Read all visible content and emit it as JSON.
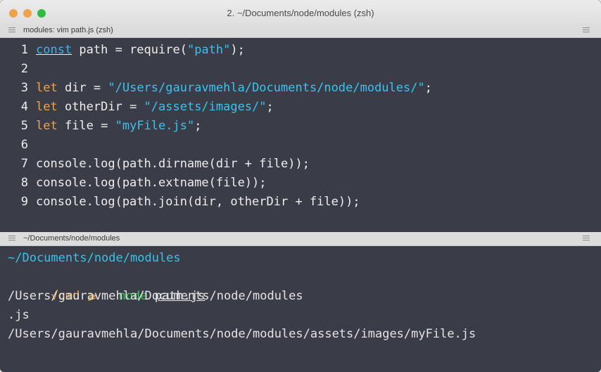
{
  "window": {
    "title": "2. ~/Documents/node/modules (zsh)"
  },
  "editor_pane": {
    "title": "modules: vim path.js (zsh)",
    "lines": [
      {
        "num": "1",
        "parts": [
          [
            "const",
            "kw-const"
          ],
          [
            " path = require(",
            ""
          ],
          [
            "\"path\"",
            "str"
          ],
          [
            ");",
            ""
          ]
        ]
      },
      {
        "num": "2",
        "parts": []
      },
      {
        "num": "3",
        "parts": [
          [
            "let",
            "kw-let"
          ],
          [
            " dir = ",
            ""
          ],
          [
            "\"/Users/gauravmehla/Documents/node/modules/\"",
            "str"
          ],
          [
            ";",
            ""
          ]
        ]
      },
      {
        "num": "4",
        "parts": [
          [
            "let",
            "kw-let"
          ],
          [
            " otherDir = ",
            ""
          ],
          [
            "\"/assets/images/\"",
            "str"
          ],
          [
            ";",
            ""
          ]
        ]
      },
      {
        "num": "5",
        "parts": [
          [
            "let",
            "kw-let"
          ],
          [
            " file = ",
            ""
          ],
          [
            "\"myFile.js\"",
            "str"
          ],
          [
            ";",
            ""
          ]
        ]
      },
      {
        "num": "6",
        "parts": []
      },
      {
        "num": "7",
        "parts": [
          [
            "console.log(path.dirname(dir + file));",
            ""
          ]
        ]
      },
      {
        "num": "8",
        "parts": [
          [
            "console.log(path.extname(file));",
            ""
          ]
        ]
      },
      {
        "num": "9",
        "parts": [
          [
            "console.log(path.join(dir, otherDir + file));",
            ""
          ]
        ]
      }
    ]
  },
  "terminal_pane": {
    "title": "~/Documents/node/modules",
    "cwd": "~/Documents/node/modules",
    "prompt": "√cmd ⩾",
    "command": "node",
    "argument": "path.js",
    "output": [
      "/Users/gauravmehla/Documents/node/modules",
      ".js",
      "/Users/gauravmehla/Documents/node/modules/assets/images/myFile.js"
    ]
  },
  "colors": {
    "background": "#3a3c48",
    "keyword_const": "#38b6e8",
    "keyword_let": "#f3a33b",
    "string": "#38c4f0",
    "prompt": "#f3a33b",
    "command": "#3ac75a"
  }
}
